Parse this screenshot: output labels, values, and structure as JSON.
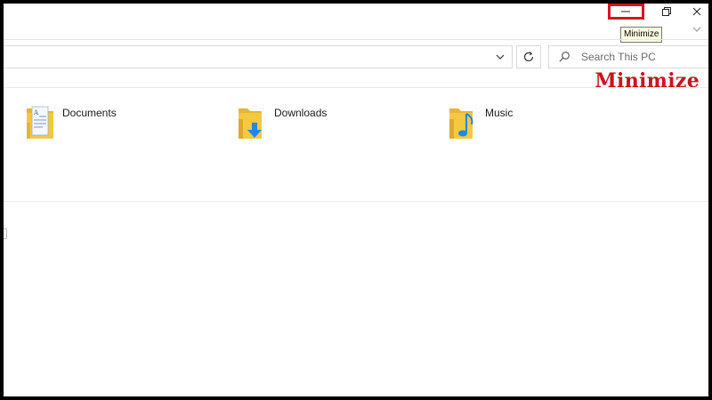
{
  "window": {
    "minimize_tooltip": "Minimize",
    "buttons": [
      "minimize",
      "maximize",
      "close"
    ]
  },
  "search": {
    "placeholder": "Search This PC"
  },
  "folders": [
    {
      "label": "Documents",
      "icon": "documents-folder-icon"
    },
    {
      "label": "Downloads",
      "icon": "downloads-folder-icon"
    },
    {
      "label": "Music",
      "icon": "music-folder-icon"
    }
  ],
  "annotation": {
    "caption": "Minimize",
    "highlight_color": "#d4141e"
  },
  "colors": {
    "folder_yellow": "#f5c842",
    "download_blue": "#1e88e5",
    "music_blue": "#1e88e5",
    "caption_red": "#c8141e"
  }
}
